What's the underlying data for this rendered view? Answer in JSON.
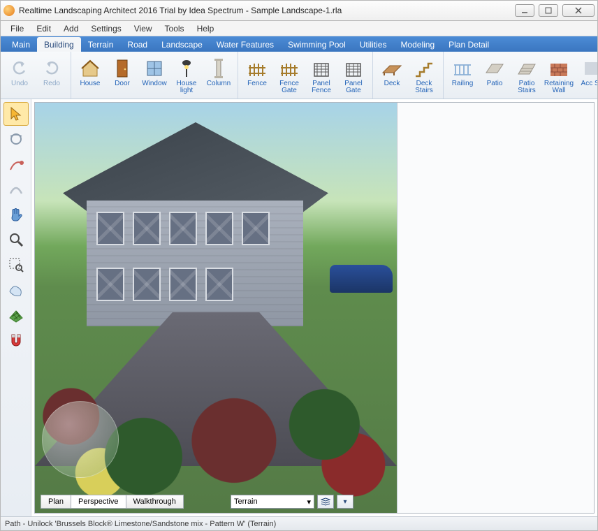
{
  "window": {
    "title": "Realtime Landscaping Architect 2016 Trial by Idea Spectrum - Sample Landscape-1.rla"
  },
  "menu": {
    "items": [
      "File",
      "Edit",
      "Add",
      "Settings",
      "View",
      "Tools",
      "Help"
    ]
  },
  "ribbon": {
    "tabs": [
      "Main",
      "Building",
      "Terrain",
      "Road",
      "Landscape",
      "Water Features",
      "Swimming Pool",
      "Utilities",
      "Modeling",
      "Plan Detail"
    ],
    "active": 1
  },
  "toolbar": {
    "groups": [
      {
        "buttons": [
          {
            "name": "undo-button",
            "label": "Undo",
            "icon": "undo",
            "disabled": true
          },
          {
            "name": "redo-button",
            "label": "Redo",
            "icon": "redo",
            "disabled": true
          }
        ]
      },
      {
        "buttons": [
          {
            "name": "house-button",
            "label": "House",
            "icon": "house"
          },
          {
            "name": "door-button",
            "label": "Door",
            "icon": "door"
          },
          {
            "name": "window-button",
            "label": "Window",
            "icon": "window"
          },
          {
            "name": "house-light-button",
            "label": "House light",
            "icon": "lamp"
          },
          {
            "name": "column-button",
            "label": "Column",
            "icon": "column"
          }
        ]
      },
      {
        "buttons": [
          {
            "name": "fence-button",
            "label": "Fence",
            "icon": "fence"
          },
          {
            "name": "fence-gate-button",
            "label": "Fence Gate",
            "icon": "fence"
          },
          {
            "name": "panel-fence-button",
            "label": "Panel Fence",
            "icon": "panel"
          },
          {
            "name": "panel-gate-button",
            "label": "Panel Gate",
            "icon": "panel"
          }
        ]
      },
      {
        "buttons": [
          {
            "name": "deck-button",
            "label": "Deck",
            "icon": "deck"
          },
          {
            "name": "deck-stairs-button",
            "label": "Deck Stairs",
            "icon": "stairs"
          }
        ]
      },
      {
        "buttons": [
          {
            "name": "railing-button",
            "label": "Railing",
            "icon": "railing"
          },
          {
            "name": "patio-button",
            "label": "Patio",
            "icon": "patio"
          },
          {
            "name": "patio-stairs-button",
            "label": "Patio Stairs",
            "icon": "pstairs"
          },
          {
            "name": "retaining-wall-button",
            "label": "Retaining Wall",
            "icon": "wall"
          },
          {
            "name": "accessory-button",
            "label": "Acc St",
            "icon": "misc"
          }
        ]
      }
    ]
  },
  "side_tools": [
    {
      "name": "select-tool",
      "icon": "cursor",
      "selected": true
    },
    {
      "name": "orbit-tool",
      "icon": "orbit"
    },
    {
      "name": "move-point-tool",
      "icon": "movepoint"
    },
    {
      "name": "curve-tool",
      "icon": "curve"
    },
    {
      "name": "pan-tool",
      "icon": "hand"
    },
    {
      "name": "zoom-tool",
      "icon": "zoom"
    },
    {
      "name": "zoom-selection-tool",
      "icon": "zoomsel"
    },
    {
      "name": "region-tool",
      "icon": "region"
    },
    {
      "name": "grid-tool",
      "icon": "grid"
    },
    {
      "name": "snap-tool",
      "icon": "magnet"
    }
  ],
  "view_tabs": {
    "items": [
      "Plan",
      "Perspective",
      "Walkthrough"
    ],
    "active": 1
  },
  "layer": {
    "selected": "Terrain"
  },
  "status": {
    "text": "Path - Unilock 'Brussels Block® Limestone/Sandstone mix - Pattern W' (Terrain)"
  }
}
